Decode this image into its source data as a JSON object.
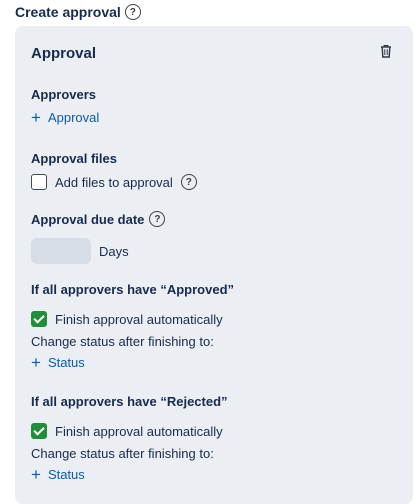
{
  "header": {
    "title": "Create approval"
  },
  "card": {
    "title": "Approval",
    "approvers": {
      "label": "Approvers",
      "add_label": "Approval"
    },
    "files": {
      "label": "Approval files",
      "checkbox_label": "Add files to approval",
      "checked": false
    },
    "due": {
      "label": "Approval due date",
      "value": "",
      "unit": "Days"
    },
    "approved": {
      "label": "If all approvers have “Approved”",
      "finish_label": "Finish approval automatically",
      "finish_checked": true,
      "change_label": "Change status after finishing to:",
      "status_label": "Status"
    },
    "rejected": {
      "label": "If all approvers have “Rejected”",
      "finish_label": "Finish approval automatically",
      "finish_checked": true,
      "change_label": "Change status after finishing to:",
      "status_label": "Status"
    }
  },
  "colors": {
    "accent": "#0b5cad",
    "check": "#1f8f3a",
    "card_bg": "#ebeef3"
  },
  "icons": [
    "help-icon",
    "trash-icon",
    "plus-icon",
    "checkbox",
    "check-icon"
  ]
}
